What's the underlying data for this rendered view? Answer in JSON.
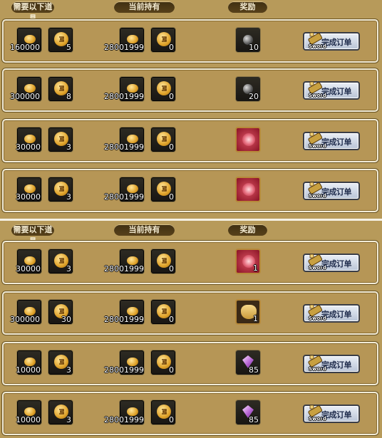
{
  "headers": {
    "required": "需要以下道具",
    "owned": "当前持有",
    "reward": "奖励"
  },
  "button_label": "完成订单",
  "button_sub": "Sword",
  "panels": [
    {
      "rows": [
        {
          "req_gold": "160000",
          "req_token": "5",
          "own_gold": "28001999",
          "own_token": "0",
          "reward_type": "bomb",
          "reward_qty": "10"
        },
        {
          "req_gold": "300000",
          "req_token": "8",
          "own_gold": "28001999",
          "own_token": "0",
          "reward_type": "bomb",
          "reward_qty": "20"
        },
        {
          "req_gold": "30000",
          "req_token": "3",
          "own_gold": "28001999",
          "own_token": "0",
          "reward_type": "red-card",
          "reward_qty": ""
        },
        {
          "req_gold": "30000",
          "req_token": "3",
          "own_gold": "28001999",
          "own_token": "0",
          "reward_type": "red-card",
          "reward_qty": ""
        }
      ]
    },
    {
      "rows": [
        {
          "req_gold": "30000",
          "req_token": "3",
          "own_gold": "28001999",
          "own_token": "0",
          "reward_type": "red-card",
          "reward_qty": "1"
        },
        {
          "req_gold": "300000",
          "req_token": "30",
          "own_gold": "28001999",
          "own_token": "0",
          "reward_type": "scroll",
          "reward_qty": "1"
        },
        {
          "req_gold": "10000",
          "req_token": "3",
          "own_gold": "28001999",
          "own_token": "0",
          "reward_type": "gem",
          "reward_qty": "85"
        },
        {
          "req_gold": "10000",
          "req_token": "3",
          "own_gold": "28001999",
          "own_token": "0",
          "reward_type": "gem",
          "reward_qty": "85"
        }
      ]
    }
  ]
}
